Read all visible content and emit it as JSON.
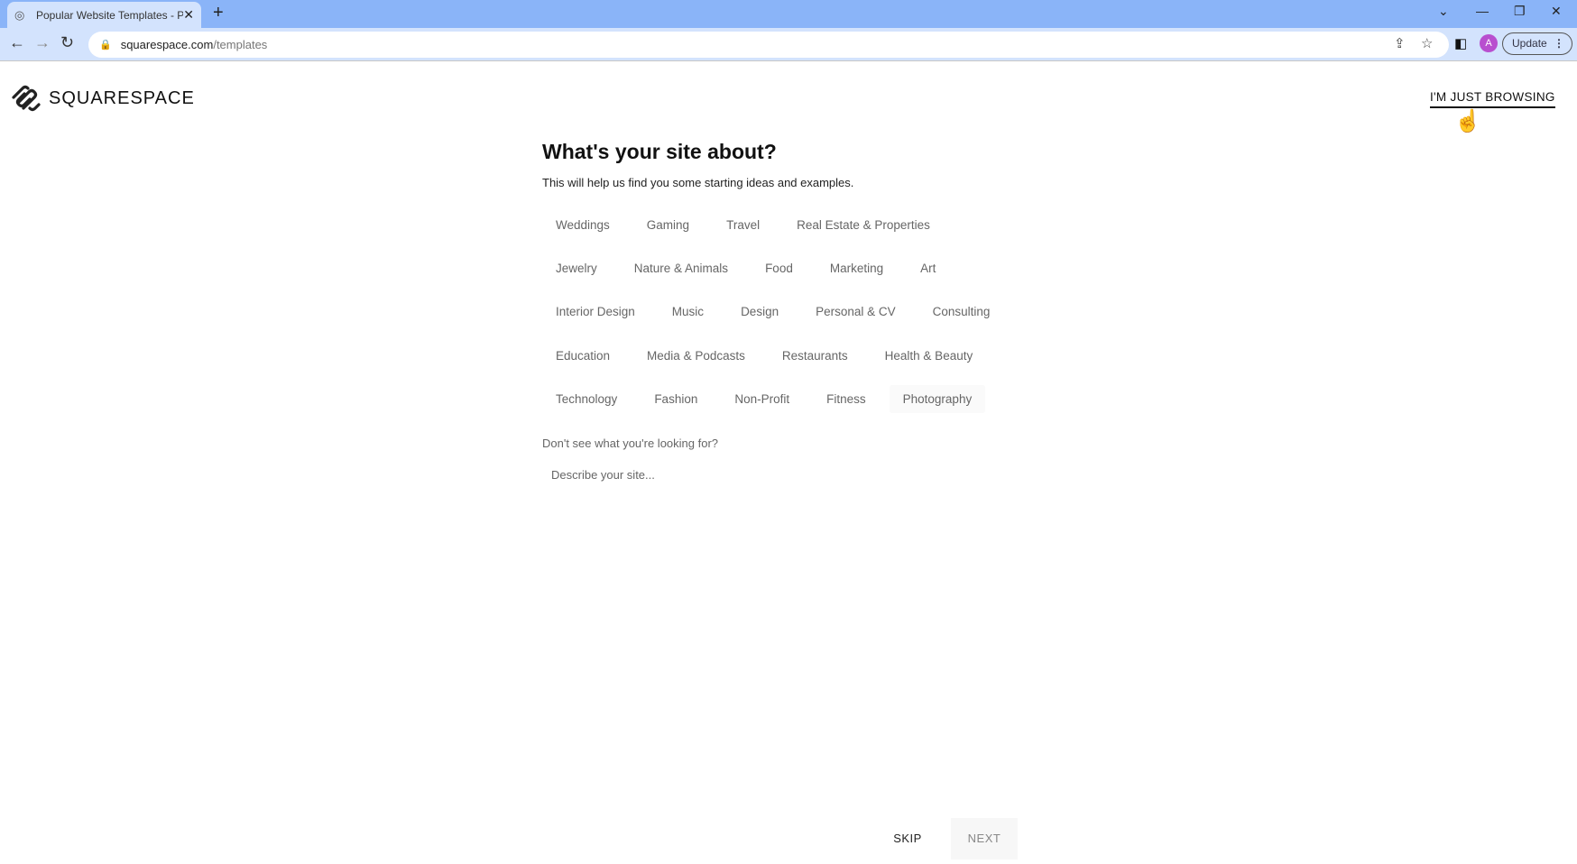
{
  "browser": {
    "tab_title": "Popular Website Templates - Popular Website Templates",
    "url_host": "squarespace.com",
    "url_path": "/templates",
    "profile_initial": "A",
    "update_label": "Update"
  },
  "header": {
    "logo_text": "SQUARESPACE",
    "browse_link": "I'M JUST BROWSING"
  },
  "main": {
    "title": "What's your site about?",
    "subtitle": "This will help us find you some starting ideas and examples.",
    "categories": [
      [
        "Weddings",
        "Gaming",
        "Travel",
        "Real Estate & Properties"
      ],
      [
        "Jewelry",
        "Nature & Animals",
        "Food",
        "Marketing",
        "Art"
      ],
      [
        "Interior Design",
        "Music",
        "Design",
        "Personal & CV",
        "Consulting"
      ],
      [
        "Education",
        "Media & Podcasts",
        "Restaurants",
        "Health & Beauty"
      ],
      [
        "Technology",
        "Fashion",
        "Non-Profit",
        "Fitness",
        "Photography"
      ]
    ],
    "custom_prompt": "Don't see what you're looking for?",
    "describe_placeholder": "Describe your site..."
  },
  "footer": {
    "skip_label": "SKIP",
    "next_label": "NEXT"
  }
}
